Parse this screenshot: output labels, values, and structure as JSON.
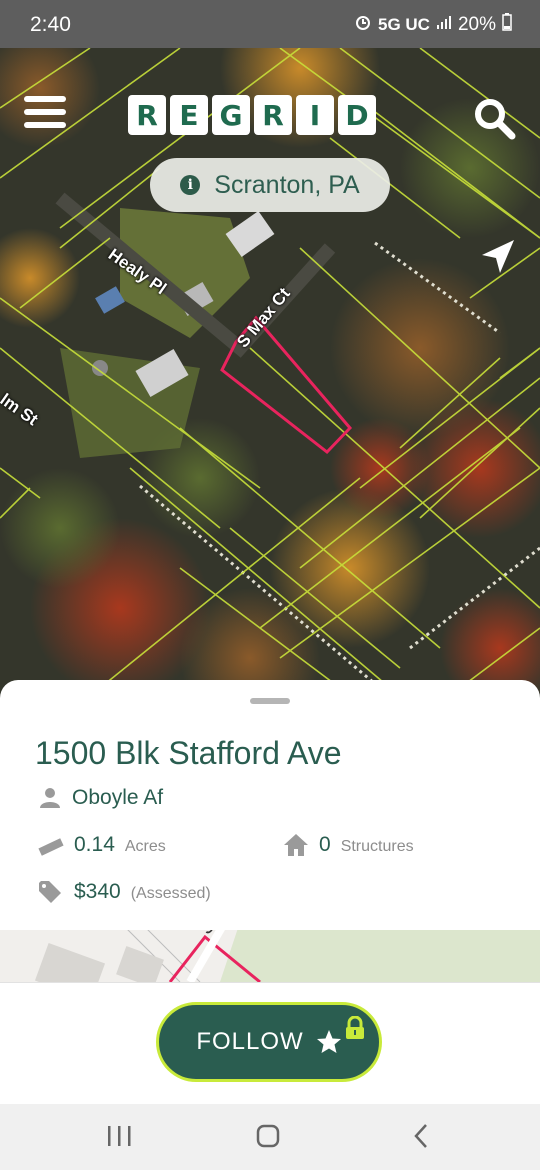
{
  "status_bar": {
    "time": "2:40",
    "network": "5G UC",
    "battery": "20%"
  },
  "header": {
    "logo_letters": [
      "R",
      "E",
      "G",
      "R",
      "I",
      "D"
    ],
    "location": "Scranton, PA"
  },
  "map": {
    "streets": [
      "Healy Pl",
      "S Max Ct",
      "lm St"
    ]
  },
  "parcel": {
    "address": "1500 Blk Stafford Ave",
    "owner": "Oboyle Af",
    "acres_value": "0.14",
    "acres_unit": "Acres",
    "structures_value": "0",
    "structures_unit": "Structures",
    "assessed_value": "$340",
    "assessed_unit": "(Assessed)"
  },
  "mini_map": {
    "label": "S"
  },
  "actions": {
    "follow_label": "FOLLOW"
  },
  "colors": {
    "brand": "#2a5d50",
    "accent": "#c8ea3a",
    "parcel_highlight": "#e8245e"
  }
}
